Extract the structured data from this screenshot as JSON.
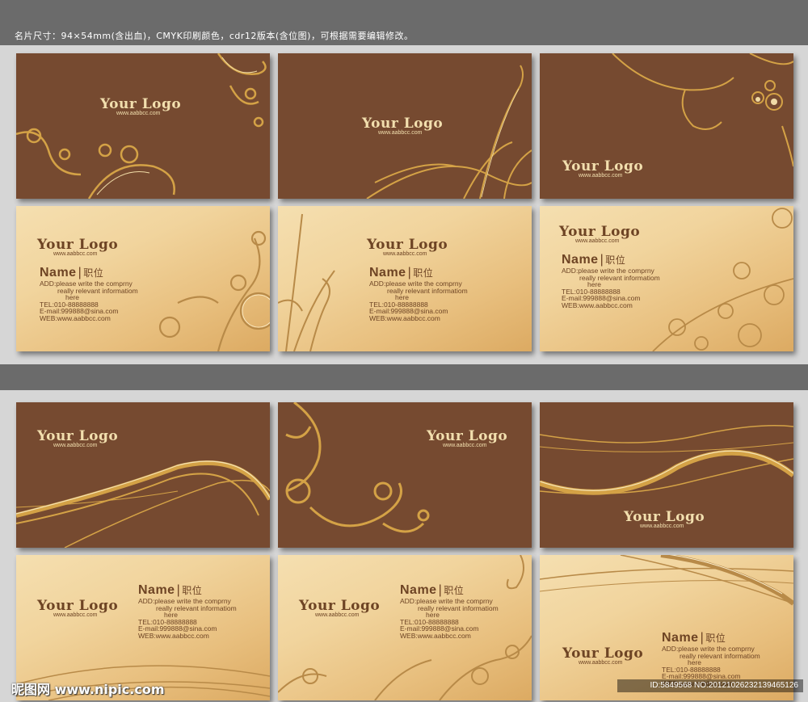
{
  "header": {
    "caption": "名片尺寸：94×54mm(含出血)，CMYK印刷颜色，cdr12版本(含位图)，可根据需要编辑修改。"
  },
  "card": {
    "logo": "Your Logo",
    "url": "www.aabbcc.com",
    "name": "Name",
    "title": "职位",
    "add1": "ADD:please write the comprny",
    "add2": "really relevant informatiom",
    "add3": "here",
    "tel": "TEL:010-88888888",
    "email": "E-mail:999888@sina.com",
    "web": "WEB:www.aabbcc.com"
  },
  "footer": {
    "watermark": "昵图网 www.nipic.com",
    "id_text": "ID:5849568 NO:20121026232139465126"
  },
  "colors": {
    "brown_card": "#764a30",
    "gold_card": "#f1d49d",
    "dark_text": "#6e4424",
    "light_text": "#f2dfae",
    "gold_ornament": "#d4a246"
  }
}
